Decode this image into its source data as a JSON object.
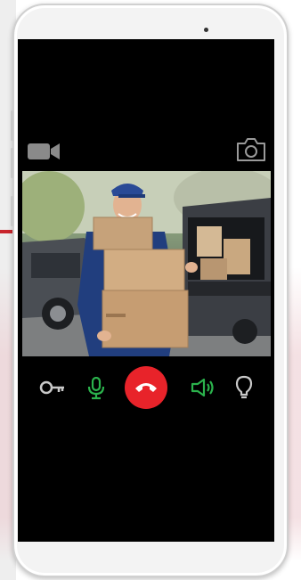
{
  "colors": {
    "screen": "#000000",
    "accept_green": "#2bb24c",
    "end_call_red": "#e8232a",
    "icon_gray": "#8a8a8a",
    "icon_light": "#c9c9c9"
  },
  "top_bar": {
    "left_icon": "video-camera-icon",
    "right_icon": "camera-snapshot-icon"
  },
  "video_feed": {
    "content": "delivery-person-with-boxes-photo"
  },
  "controls": [
    {
      "name": "key-icon",
      "color": "#c9c9c9"
    },
    {
      "name": "microphone-icon",
      "color": "#2bb24c"
    },
    {
      "name": "end-call-icon",
      "color": "#e8232a"
    },
    {
      "name": "speaker-icon",
      "color": "#2bb24c"
    },
    {
      "name": "light-bulb-icon",
      "color": "#c9c9c9"
    }
  ]
}
